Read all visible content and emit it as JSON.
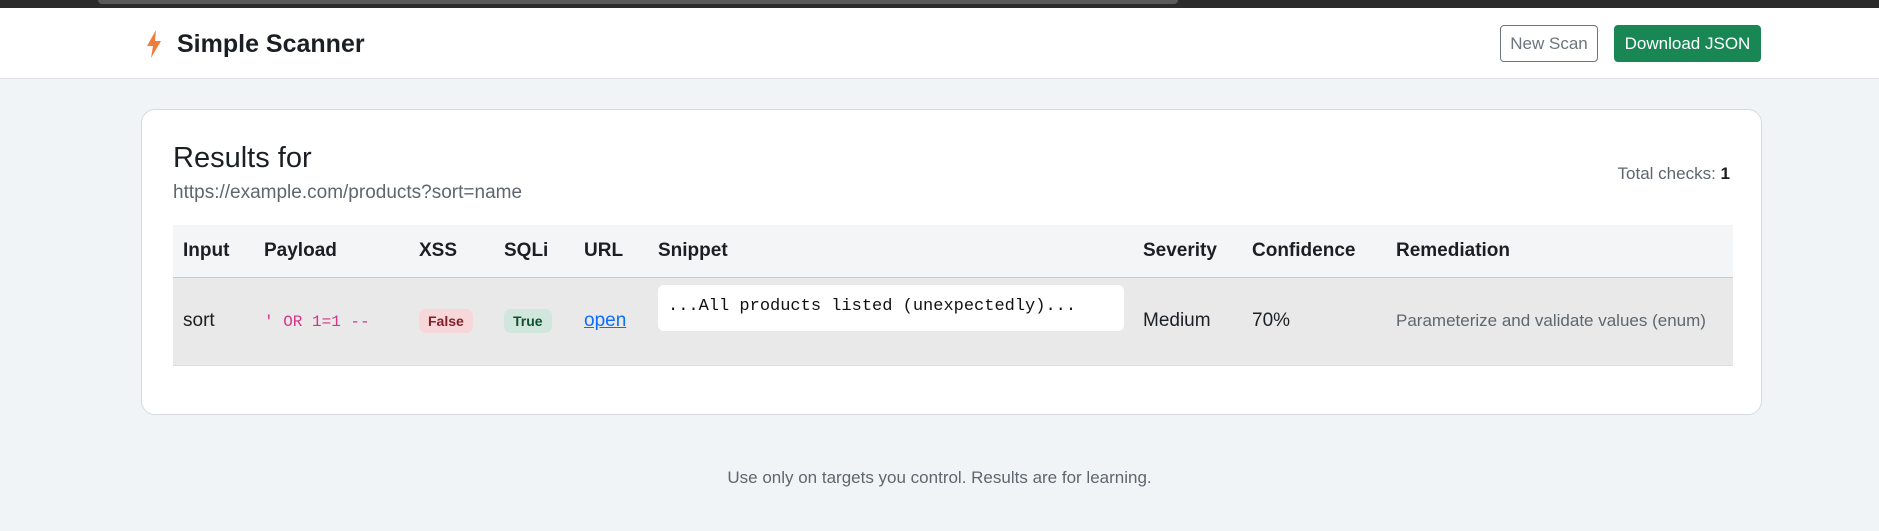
{
  "app": {
    "title": "Simple Scanner",
    "brand_icon": "lightning-bolt-icon",
    "accent_color": "#f07c3c"
  },
  "toolbar": {
    "new_scan_label": "New Scan",
    "download_label": "Download JSON",
    "download_color": "#198754"
  },
  "results": {
    "heading": "Results for",
    "target_url": "https://example.com/products?sort=name",
    "total_label": "Total checks:",
    "total_value": "1"
  },
  "table": {
    "headers": [
      "Input",
      "Payload",
      "XSS",
      "SQLi",
      "URL",
      "Snippet",
      "Severity",
      "Confidence",
      "Remediation"
    ],
    "rows": [
      {
        "input": "sort",
        "payload": "' OR 1=1 --",
        "xss": "False",
        "sqli": "True",
        "url_label": "open",
        "snippet": "...All products listed (unexpectedly)...",
        "severity": "Medium",
        "confidence": "70%",
        "remediation": "Parameterize and validate values (enum)"
      }
    ]
  },
  "footer": {
    "note": "Use only on targets you control. Results are for learning."
  }
}
